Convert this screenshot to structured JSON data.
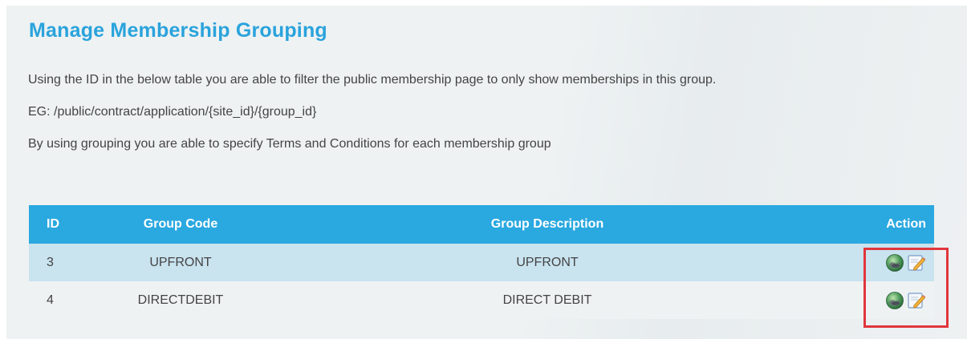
{
  "page": {
    "title": "Manage Membership Grouping",
    "paragraphs": [
      "Using the ID in the below table you are able to filter the public membership page to only show memberships in this group.",
      "EG: /public/contract/application/{site_id}/{group_id}",
      "By using grouping you are able to specify Terms and Conditions for each membership group"
    ]
  },
  "table": {
    "headers": {
      "id": "ID",
      "code": "Group Code",
      "description": "Group Description",
      "action": "Action"
    },
    "rows": [
      {
        "id": "3",
        "code": "UPFRONT",
        "description": "UPFRONT",
        "actions": [
          "view-globe-icon",
          "edit-pencil-icon"
        ]
      },
      {
        "id": "4",
        "code": "DIRECTDEBIT",
        "description": "DIRECT DEBIT",
        "actions": [
          "view-globe-icon",
          "edit-pencil-icon"
        ]
      }
    ]
  },
  "colors": {
    "title": "#2aa3dc",
    "header_bg": "#2aa8e0",
    "row_alt_bg": "#c9e3ef",
    "highlight_border": "#e0363c"
  }
}
